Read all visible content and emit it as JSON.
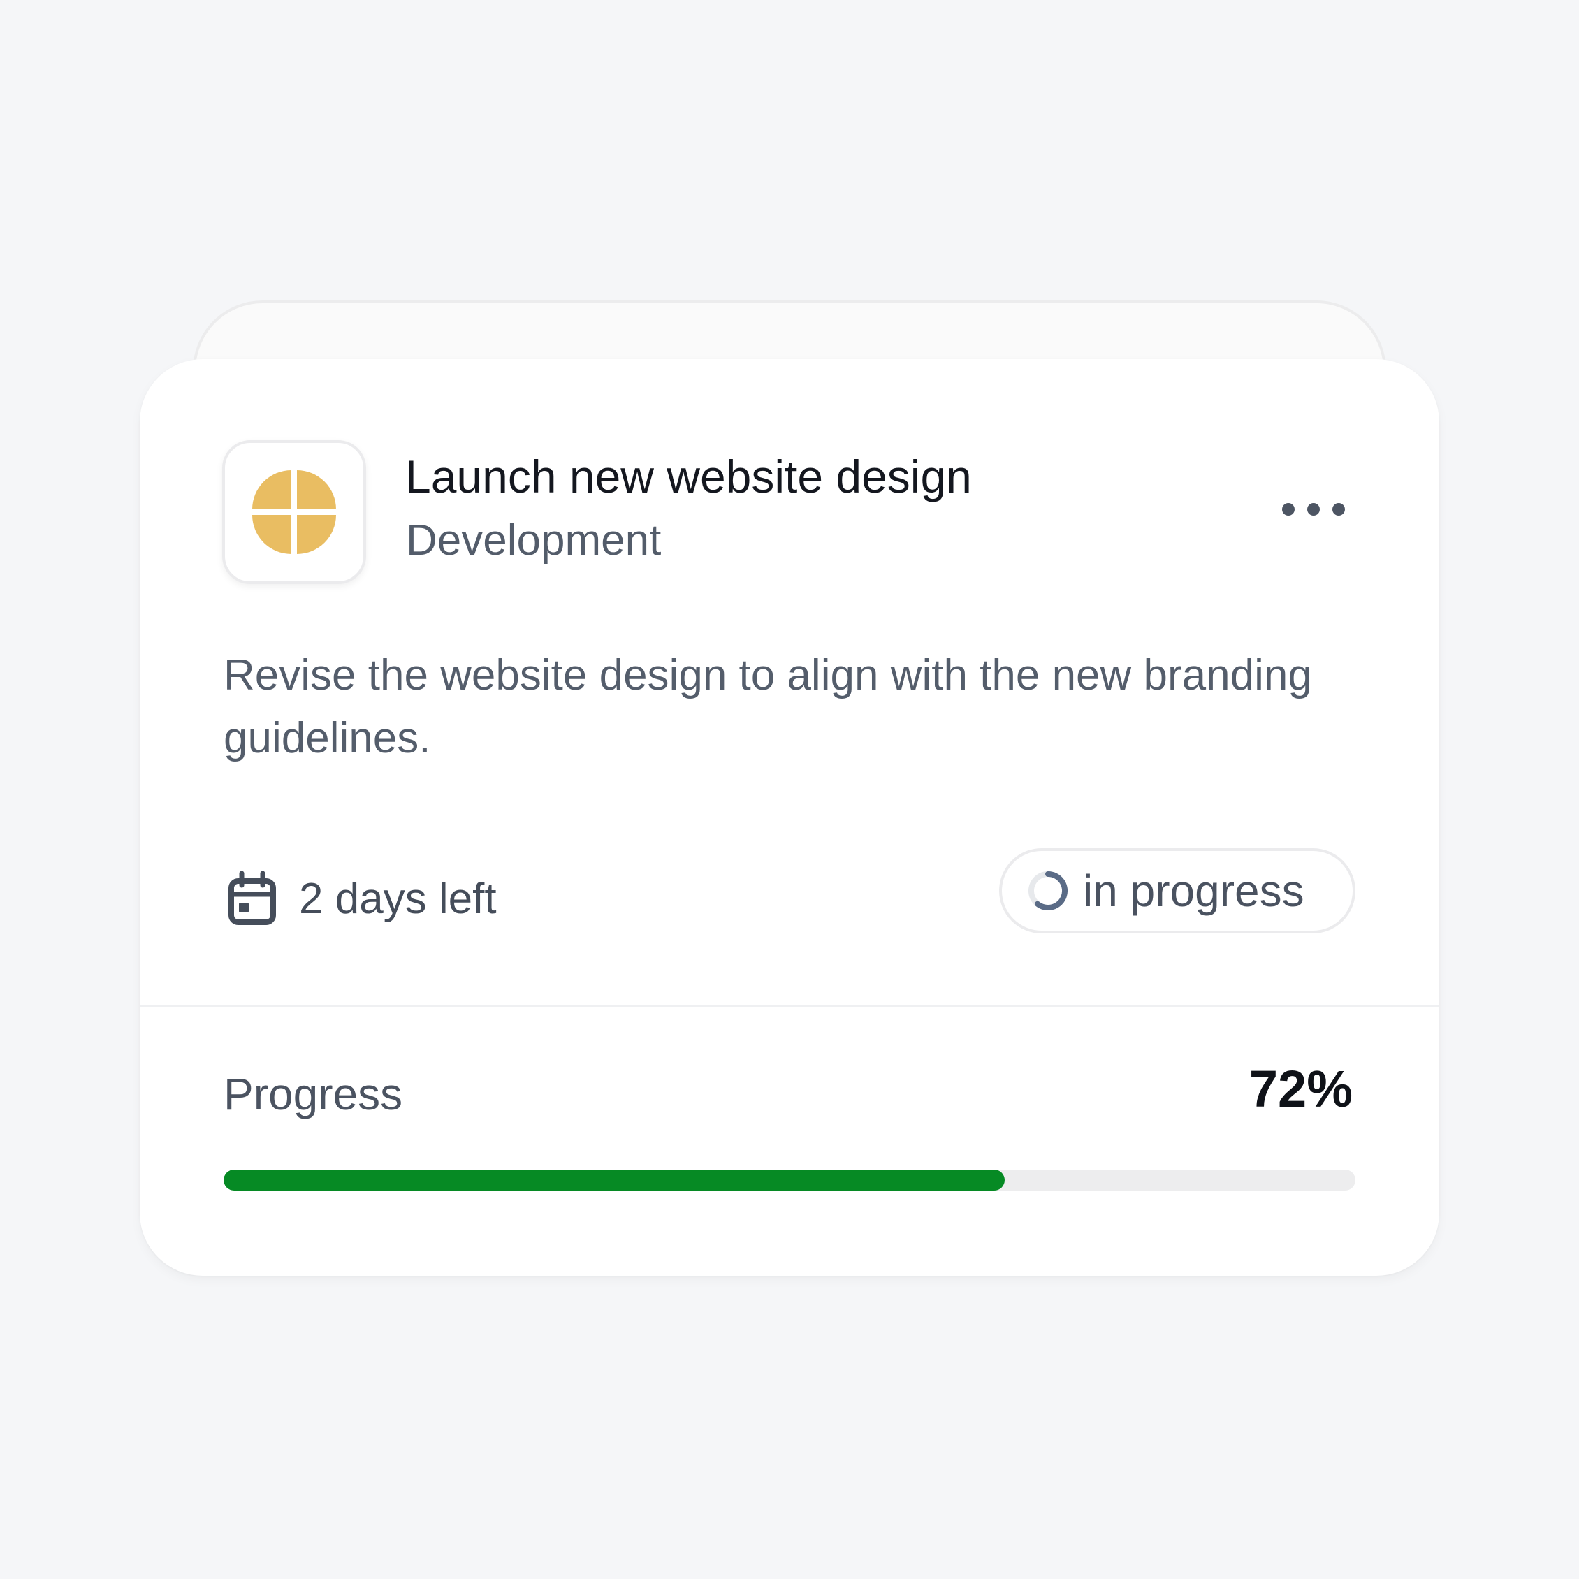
{
  "task": {
    "title": "Launch new website design",
    "category": "Development",
    "description": "Revise the website design to align with the new branding guidelines.",
    "due_text": "2 days left",
    "status": "in progress",
    "progress_label": "Progress",
    "progress_value": "72%",
    "progress_fraction": 0.69
  },
  "icons": {
    "logo": "sparkle-logo-icon",
    "more": "more-horizontal-icon",
    "calendar": "calendar-icon",
    "status": "progress-ring-icon"
  },
  "colors": {
    "logo_gold": "#e9bd62",
    "progress_fill": "#068a24",
    "status_ring": "#5a6b86"
  }
}
